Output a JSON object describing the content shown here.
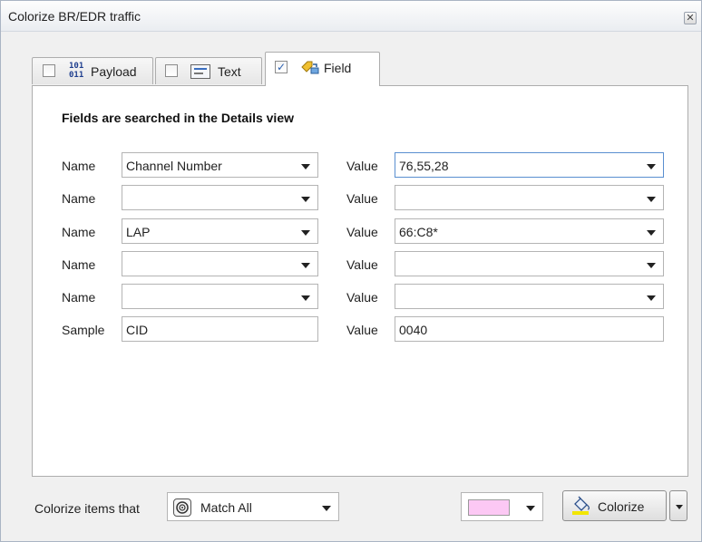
{
  "window": {
    "title": "Colorize BR/EDR traffic",
    "close_glyph": "✕"
  },
  "tabs": [
    {
      "label": "Payload",
      "icon": "binary-icon",
      "icon_text_top": "101",
      "icon_text_bottom": "011",
      "checked": false
    },
    {
      "label": "Text",
      "icon": "text-field-icon",
      "checked": false
    },
    {
      "label": "Field",
      "icon": "field-tag-icon",
      "checked": true,
      "check_glyph": "✓"
    }
  ],
  "heading": "Fields are searched in the Details view",
  "rows": [
    {
      "name_label": "Name",
      "name_value": "Channel Number",
      "value_label": "Value",
      "value": "76,55,28"
    },
    {
      "name_label": "Name",
      "name_value": "",
      "value_label": "Value",
      "value": ""
    },
    {
      "name_label": "Name",
      "name_value": "LAP",
      "value_label": "Value",
      "value": "66:C8*"
    },
    {
      "name_label": "Name",
      "name_value": "",
      "value_label": "Value",
      "value": ""
    },
    {
      "name_label": "Name",
      "name_value": "",
      "value_label": "Value",
      "value": ""
    }
  ],
  "sample": {
    "label": "Sample",
    "value": "CID",
    "value_label": "Value",
    "value_text": "0040"
  },
  "footer": {
    "colorize_items_label": "Colorize items that",
    "match_value": "Match All",
    "match_icon": "match-all-icon",
    "selected_color": "#fcc8f4",
    "colorize_button": "Colorize",
    "colorize_icon": "paint-bucket-icon"
  }
}
